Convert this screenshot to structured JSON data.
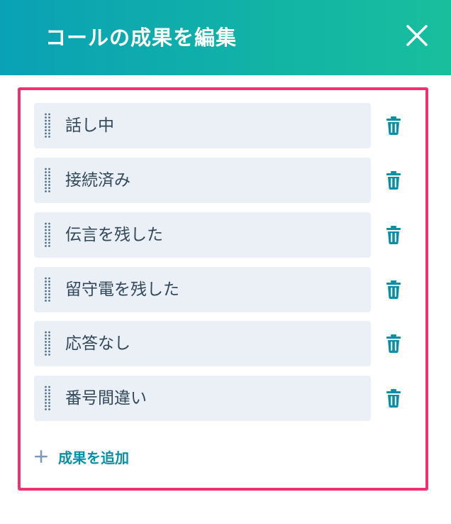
{
  "header": {
    "title": "コールの成果を編集",
    "close_icon": "close-icon"
  },
  "outcomes": [
    {
      "label": "話し中"
    },
    {
      "label": "接続済み"
    },
    {
      "label": "伝言を残した"
    },
    {
      "label": "留守電を残した"
    },
    {
      "label": "応答なし"
    },
    {
      "label": "番号間違い"
    }
  ],
  "add_button": {
    "label": "成果を追加",
    "icon": "plus-icon"
  },
  "icons": {
    "drag": "drag-handle-icon",
    "delete": "trash-icon"
  },
  "colors": {
    "header_gradient_start": "#0aa1b6",
    "header_gradient_end": "#18bf9d",
    "highlight_border": "#f0316f",
    "field_background": "#eaf0f6",
    "text": "#33475b",
    "accent": "#0b8fa6",
    "plus": "#7c98b6"
  }
}
